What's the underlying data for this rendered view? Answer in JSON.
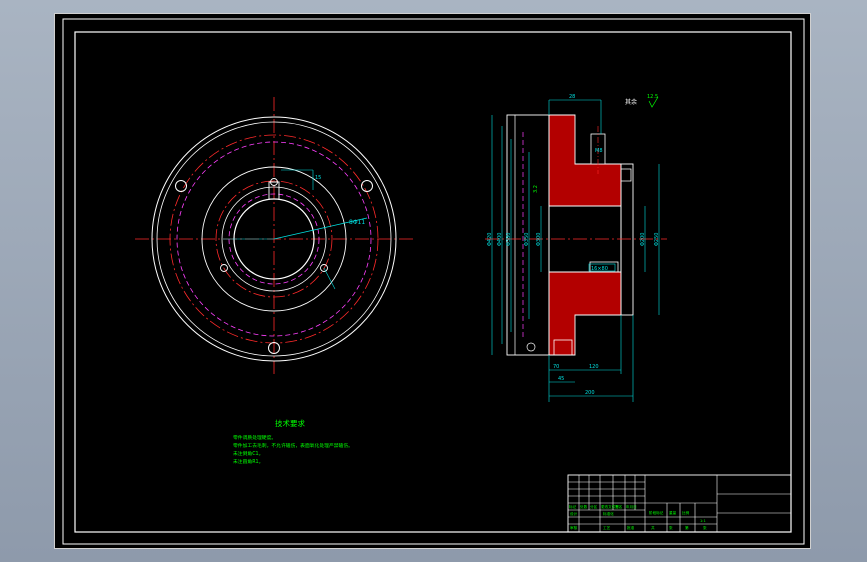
{
  "drawing": {
    "tech_requirements": {
      "title": "技术要求",
      "lines": [
        "零件调质处理硬度。",
        "零件加工去毛刺，不允许磕伤，表面氧化处理严禁磕伤。",
        "未注倒角C1。",
        "未注圆角R1。"
      ]
    },
    "surface_finish_note": "其余",
    "surface_finish_value": "12.5",
    "front_view": {
      "hole_callout": "8Φ11",
      "small_dim": "15"
    },
    "section_view": {
      "top_dim": "28",
      "thread_callout": "M8",
      "left_dims": [
        "Φ420",
        "Φ400",
        "Φ380",
        "Φ350",
        "Φ300"
      ],
      "bore_dims": [
        "Φ200",
        "Φ250"
      ],
      "key_callout": "16×80",
      "bottom_dims": [
        "70",
        "45",
        "120"
      ],
      "overall_dim": "200",
      "roughness_side": "3.2"
    },
    "title_block": {
      "row_labels": [
        "标记",
        "处数",
        "分区",
        "更改文件号",
        "签名",
        "年月日"
      ],
      "design_row": [
        "设计",
        "标准化"
      ],
      "stage_labels": [
        "阶段标记",
        "重量",
        "比例"
      ],
      "scale": "1:1",
      "bottom_row": [
        "审核",
        "工艺",
        "批准",
        "共",
        "张",
        "第",
        "张"
      ]
    }
  },
  "colors": {
    "background": "#000000",
    "outline": "#ffffff",
    "center": "#ff2a2a",
    "hidden": "#ff40ff",
    "dimension": "#00e1e1",
    "text": "#00ff00",
    "hatch": "#ff0000",
    "frame": "#ffffff"
  }
}
